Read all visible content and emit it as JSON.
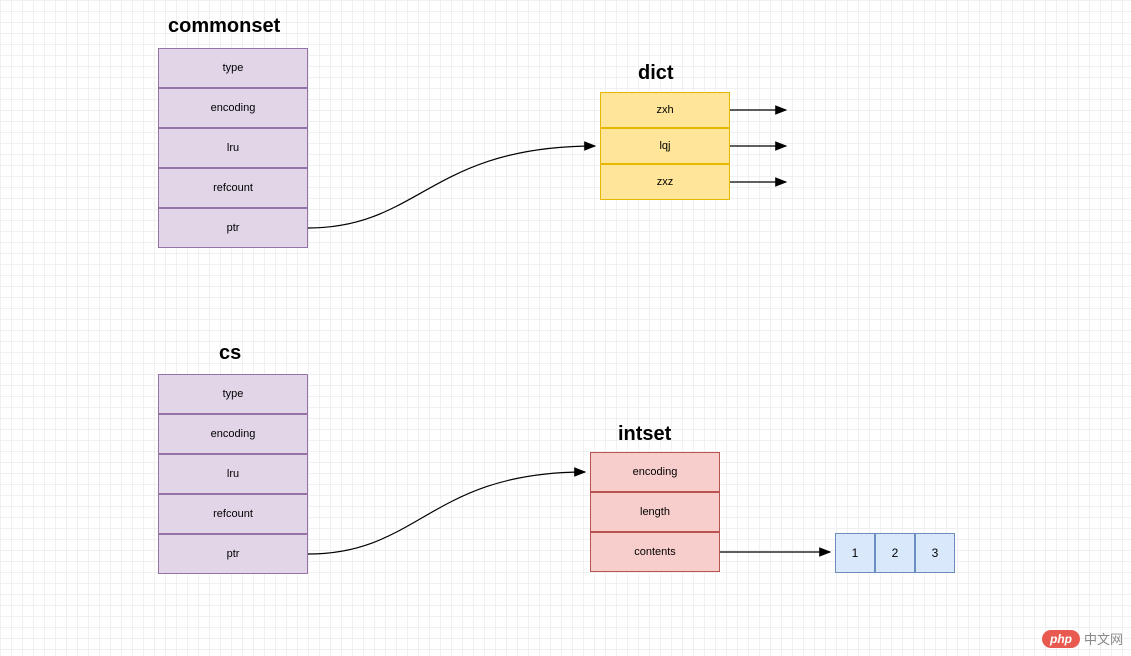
{
  "diagram1": {
    "title": "commonset",
    "rows": [
      "type",
      "encoding",
      "lru",
      "refcount",
      "ptr"
    ],
    "target_title": "dict",
    "target_rows": [
      "zxh",
      "lqj",
      "zxz"
    ]
  },
  "diagram2": {
    "title": "cs",
    "rows": [
      "type",
      "encoding",
      "lru",
      "refcount",
      "ptr"
    ],
    "target_title": "intset",
    "target_rows": [
      "encoding",
      "length",
      "contents"
    ],
    "array": [
      "1",
      "2",
      "3"
    ]
  },
  "watermark": {
    "logo": "php",
    "text": "中文网"
  }
}
